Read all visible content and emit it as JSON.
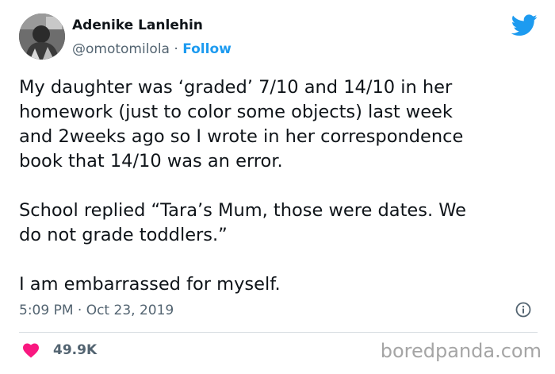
{
  "author": {
    "name": "Adenike Lanlehin",
    "handle": "@omotomilola",
    "separator": "·",
    "follow_label": "Follow"
  },
  "tweet": {
    "text": "My daughter was ‘graded’ 7/10 and 14/10 in her\nhomework (just to color some objects) last week\nand 2weeks ago so I wrote in her correspondence\nbook that 14/10 was an error.\n\nSchool replied “Tara’s Mum, those were dates. We\ndo not grade toddlers.”\n\nI am embarrassed for myself.",
    "timestamp": "5:09 PM · Oct 23, 2019",
    "like_count": "49.9K"
  },
  "watermark": "boredpanda.com",
  "icons": {
    "brand": "twitter-bird-icon",
    "info": "info-icon",
    "like": "heart-icon"
  },
  "colors": {
    "accent": "#1d9bf0",
    "heart": "#f91880",
    "secondary_text": "#536471",
    "watermark": "#a5a5a5"
  }
}
